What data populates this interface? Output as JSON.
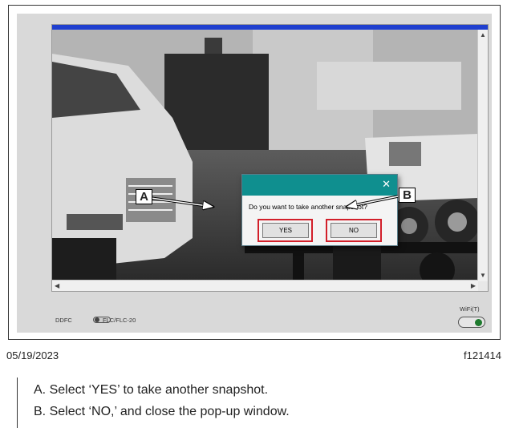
{
  "dialog": {
    "message": "Do you want to take another snapshot?",
    "close_glyph": "✕",
    "yes_label": "YES",
    "no_label": "NO"
  },
  "callouts": {
    "a": "A",
    "b": "B"
  },
  "controls": {
    "ddfc_label": "DDFC",
    "toggle_label": "FLC/FLC-20",
    "wifi_label": "WiFi(T)"
  },
  "scroll": {
    "up": "▲",
    "down": "▼",
    "left": "◀",
    "right": "▶"
  },
  "figure_meta": {
    "date": "05/19/2023",
    "code": "f121414"
  },
  "caption": {
    "a_letter": "A.",
    "a_text": "Select ‘YES’ to take another snapshot.",
    "b_letter": "B.",
    "b_text": "Select ‘NO,’ and close the pop-up window."
  },
  "colors": {
    "dialog_title": "#0f8f8f",
    "highlight": "#d21f2a",
    "top_bar": "#1f3fcf",
    "wifi_indicator": "#1e7a2e"
  },
  "icons": [
    "close-icon",
    "scroll-up-icon",
    "scroll-down-icon",
    "scroll-left-icon",
    "scroll-right-icon",
    "toggle-switch-icon",
    "wifi-indicator-icon"
  ]
}
